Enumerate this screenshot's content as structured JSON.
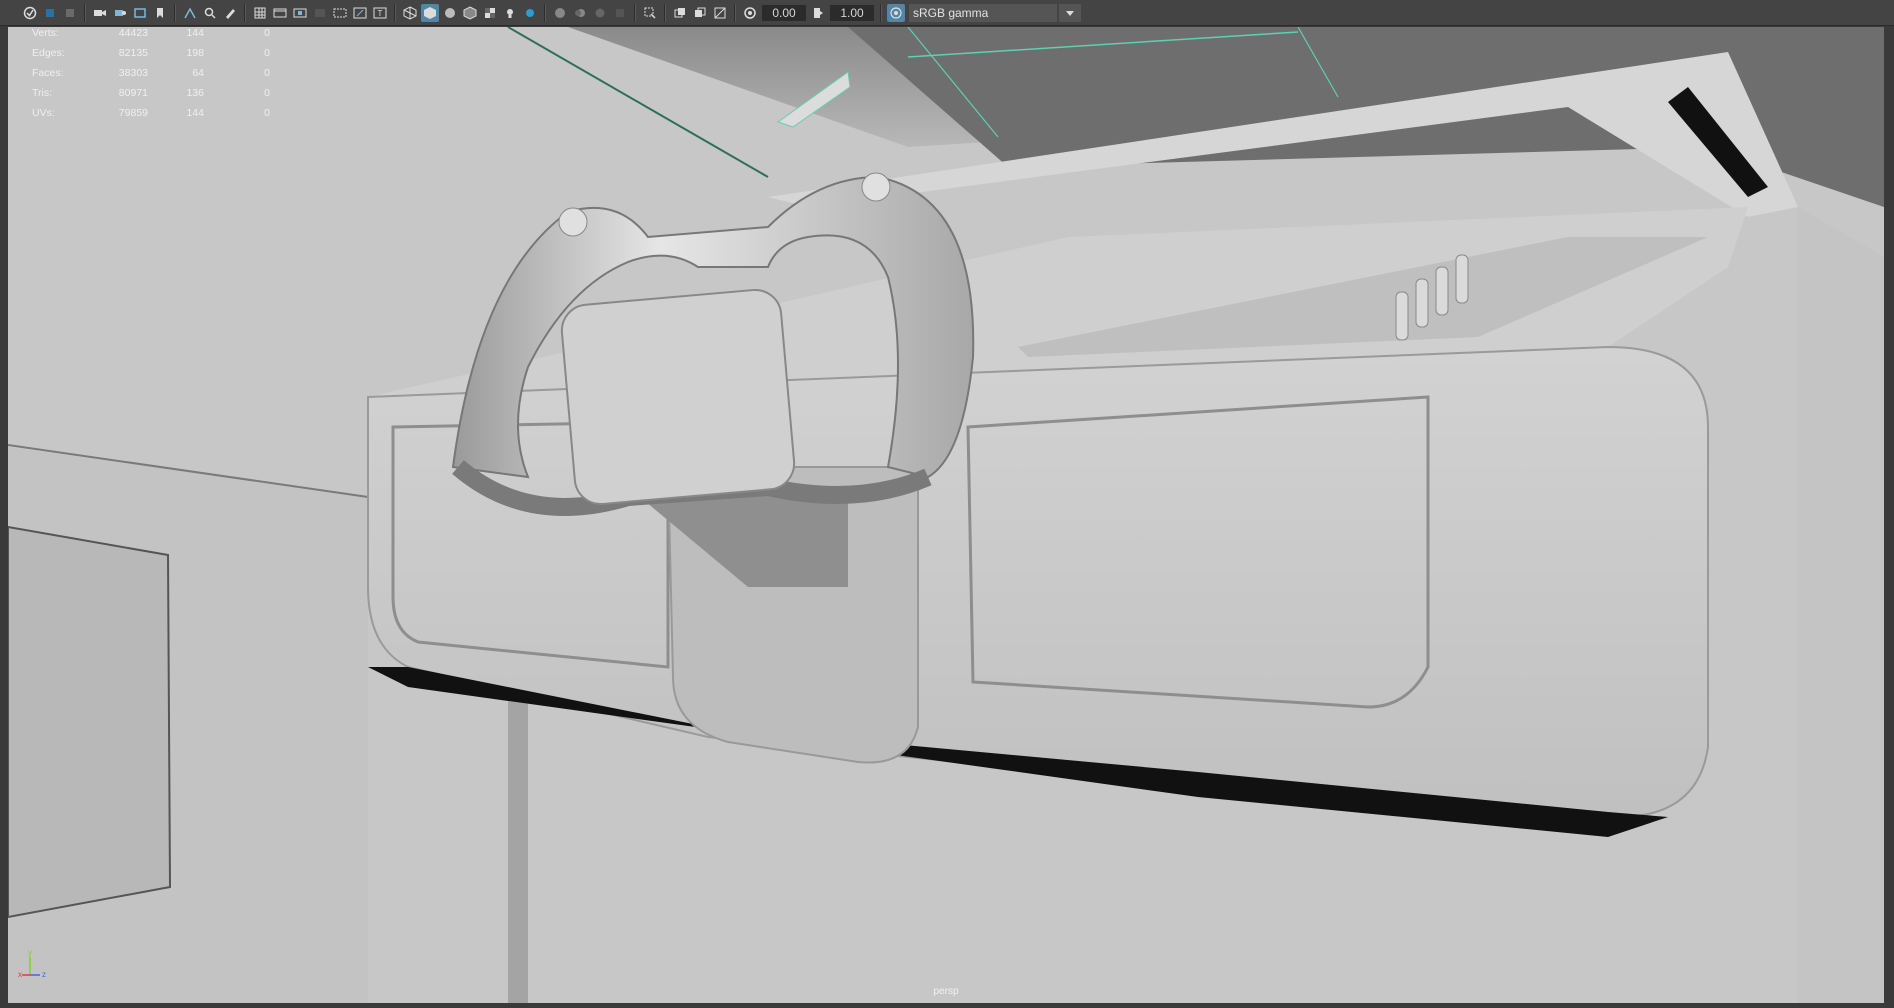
{
  "toolbar": {
    "icons": [
      "select-camera-icon",
      "lock-camera-icon",
      "bookmark-icon",
      "camera-icon",
      "camera-attributes-icon",
      "image-plane-icon",
      "two-d-pan-icon",
      "grease-pencil-icon",
      "grid-icon",
      "film-gate-icon",
      "resolution-gate-icon",
      "gate-mask-icon",
      "field-chart-icon",
      "safe-action-icon",
      "safe-title-icon",
      "wireframe-icon",
      "smooth-shade-icon",
      "default-material-icon",
      "shaded-wireframe-icon",
      "textured-icon",
      "lighting-icon",
      "shadows-icon",
      "ambient-occlusion-icon",
      "motion-blur-icon",
      "anti-aliasing-icon",
      "depth-of-field-icon",
      "isolate-select-icon",
      "xray-icon",
      "xray-joints-icon",
      "backface-culling-icon",
      "exposure-icon",
      "gamma-icon",
      "color-management-icon"
    ],
    "exposure_value": "0.00",
    "gamma_value": "1.00",
    "color_space": "sRGB gamma",
    "accent_color": "#5285a6"
  },
  "hud": {
    "rows": [
      {
        "label": "Verts:",
        "v1": "44423",
        "v2": "144",
        "v3": "0"
      },
      {
        "label": "Edges:",
        "v1": "82135",
        "v2": "198",
        "v3": "0"
      },
      {
        "label": "Faces:",
        "v1": "38303",
        "v2": "64",
        "v3": "0"
      },
      {
        "label": "Tris:",
        "v1": "80971",
        "v2": "136",
        "v3": "0"
      },
      {
        "label": "UVs:",
        "v1": "79859",
        "v2": "144",
        "v3": "0"
      }
    ]
  },
  "viewport": {
    "camera": "persp",
    "axis": {
      "x": "x",
      "y": "y",
      "z": "z"
    },
    "background": "#c9c9c9"
  }
}
